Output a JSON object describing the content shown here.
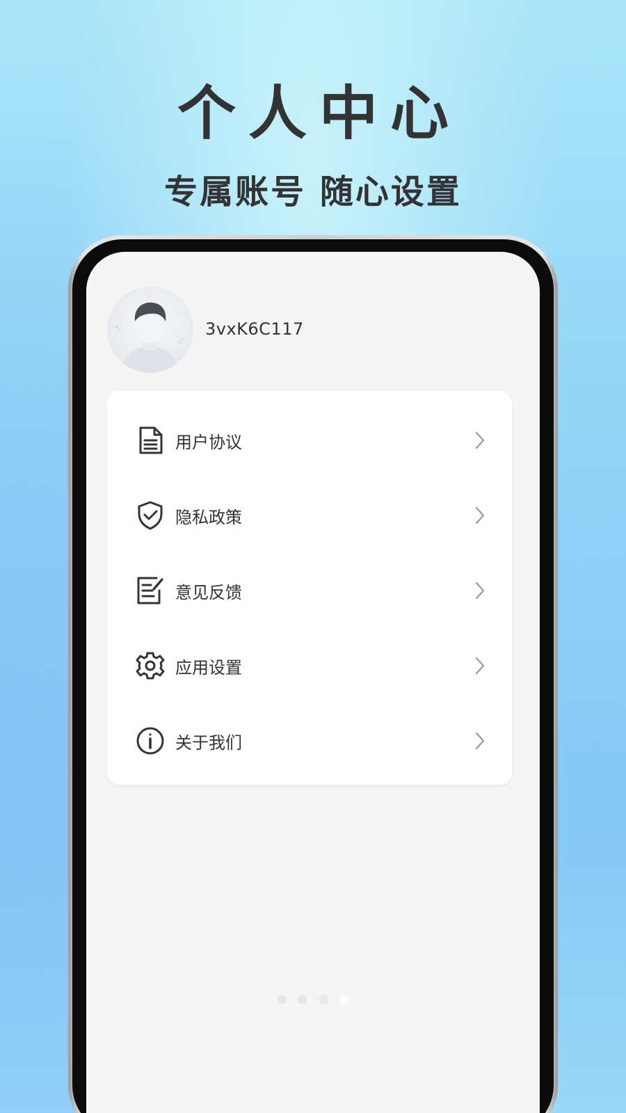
{
  "hero": {
    "title": "个人中心",
    "subtitle": "专属账号 随心设置"
  },
  "profile": {
    "username": "3vxK6C117",
    "avatar_icon": "default-avatar-icon"
  },
  "menu": {
    "items": [
      {
        "label": "用户协议",
        "icon": "document-icon"
      },
      {
        "label": "隐私政策",
        "icon": "shield-check-icon"
      },
      {
        "label": "意见反馈",
        "icon": "feedback-edit-icon"
      },
      {
        "label": "应用设置",
        "icon": "gear-icon"
      },
      {
        "label": "关于我们",
        "icon": "info-icon"
      }
    ]
  },
  "pager": {
    "count": 4,
    "active_index": 3
  },
  "colors": {
    "text": "#333333",
    "chevron": "#999999",
    "screen_bg": "#f5f5f5",
    "card_bg": "#ffffff"
  }
}
